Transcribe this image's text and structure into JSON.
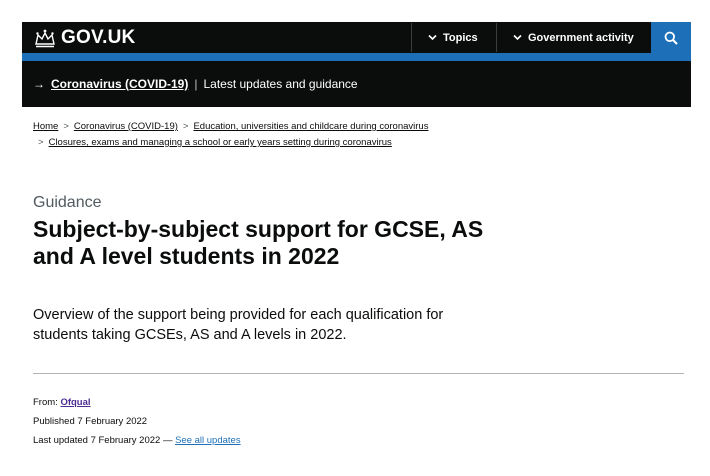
{
  "header": {
    "logo_text": "GOV.UK",
    "nav": {
      "topics": "Topics",
      "government_activity": "Government activity"
    },
    "search_label": "Search"
  },
  "banner": {
    "arrow": "→",
    "link": "Coronavirus (COVID-19)",
    "separator": "|",
    "text": "Latest updates and guidance"
  },
  "breadcrumb": {
    "separator": ">",
    "items": [
      "Home",
      "Coronavirus (COVID-19)",
      "Education, universities and childcare during coronavirus",
      "Closures, exams and managing a school or early years setting during coronavirus"
    ]
  },
  "page": {
    "caption": "Guidance",
    "title": "Subject-by-subject support for GCSE, AS and A level students in 2022",
    "lead": "Overview of the support being provided for each qualification for students taking GCSEs, AS and A levels in 2022."
  },
  "meta": {
    "from_label": "From:",
    "from_org": "Ofqual",
    "published_label": "Published",
    "published_date": "7 February 2022",
    "updated_label": "Last updated",
    "updated_date": "7 February 2022",
    "dash": "—",
    "see_all": "See all updates"
  },
  "colors": {
    "header": "#0b0c0c",
    "brand_blue": "#1d70b8",
    "link_visited": "#4c2c92",
    "secondary_text": "#505a5f"
  }
}
